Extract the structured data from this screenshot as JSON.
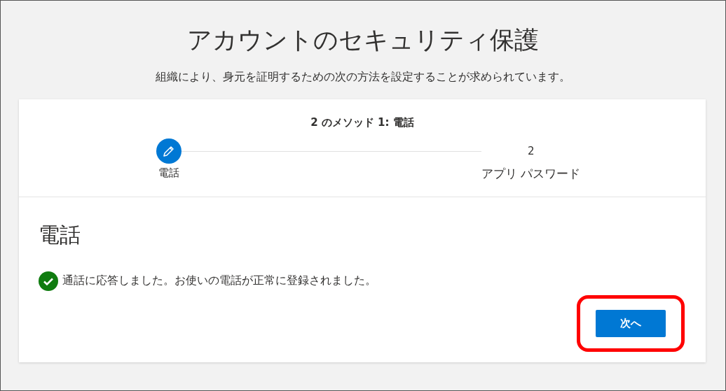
{
  "title": "アカウントのセキュリティ保護",
  "subtitle": "組織により、身元を証明するための次の方法を設定することが求められています。",
  "card": {
    "progress_title": "2 のメソッド 1: 電話",
    "steps": [
      {
        "label": "電話",
        "selected": true
      },
      {
        "number": "2",
        "label": "アプリ パスワード",
        "selected": false
      }
    ],
    "section_title": "電話",
    "message": {
      "kind": "success",
      "text": "通話に応答しました。お使いの電話が正常に登録されました。"
    },
    "next_button": {
      "label": "次へ",
      "highlighted": true
    }
  }
}
